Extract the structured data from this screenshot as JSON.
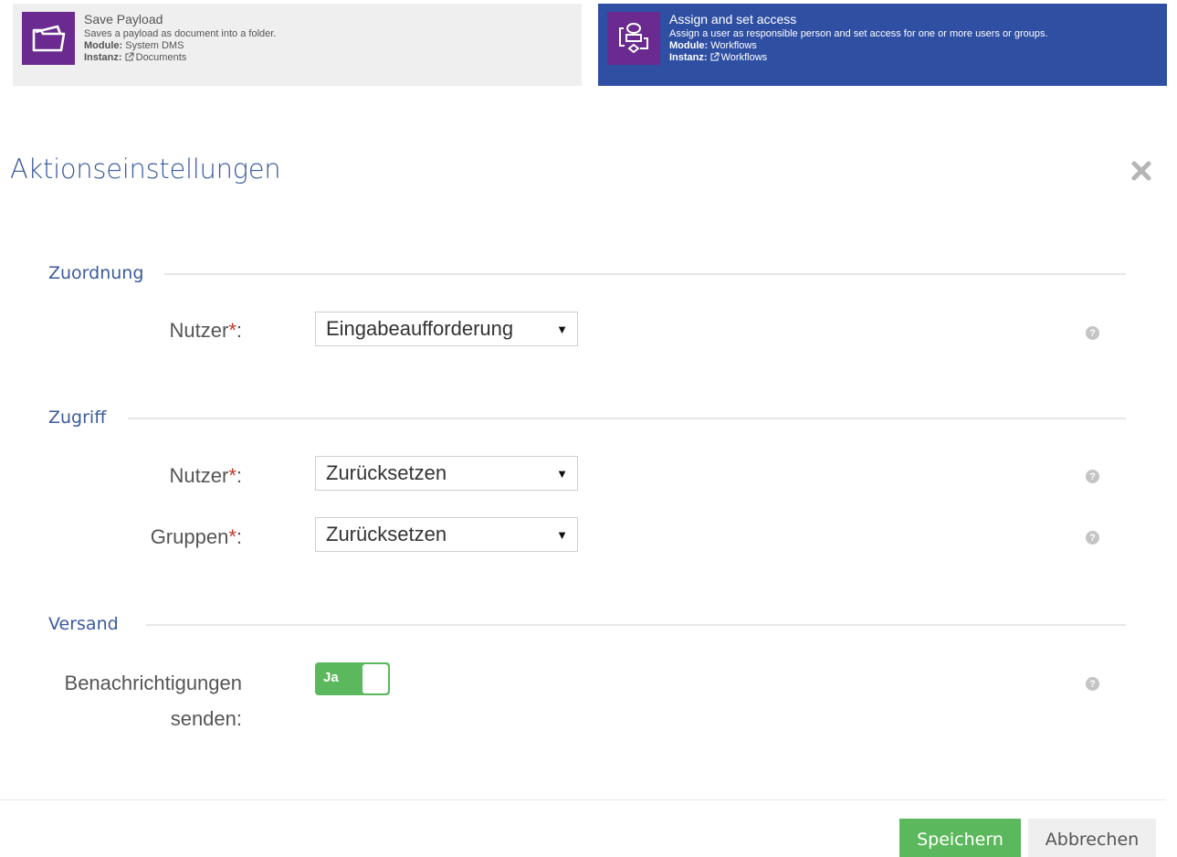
{
  "cards": [
    {
      "title": "Save Payload",
      "description": "Saves a payload as document into a folder.",
      "module_label": "Module:",
      "module_value": "System DMS",
      "instance_label": "Instanz:",
      "instance_value": "Documents",
      "icon": "folder-icon"
    },
    {
      "title": "Assign and set access",
      "description": "Assign a user as responsible person and set access for one or more users or groups.",
      "module_label": "Module:",
      "module_value": "Workflows",
      "instance_label": "Instanz:",
      "instance_value": "Workflows",
      "icon": "workflow-icon"
    }
  ],
  "dialog": {
    "title": "Aktionseinstellungen",
    "close_icon": "close-icon"
  },
  "sections": {
    "zuordnung": {
      "legend": "Zuordnung",
      "user_label": "Nutzer",
      "user_value": "Eingabeaufforderung"
    },
    "zugriff": {
      "legend": "Zugriff",
      "user_label": "Nutzer",
      "user_value": "Zurücksetzen",
      "groups_label": "Gruppen",
      "groups_value": "Zurücksetzen"
    },
    "versand": {
      "legend": "Versand",
      "notify_label_line1": "Benachrichtigungen",
      "notify_label_line2": "senden:",
      "toggle_label": "Ja",
      "toggle_on": true
    }
  },
  "required_mark": "*",
  "colon": ":",
  "help_glyph": "?",
  "caret_glyph": "▼",
  "footer": {
    "save_label": "Speichern",
    "cancel_label": "Abbrechen"
  },
  "colors": {
    "accent": "#3a5a9e",
    "card_active": "#2f4fa3",
    "icon_bg": "#6a2a8f",
    "success": "#5cb85c"
  }
}
